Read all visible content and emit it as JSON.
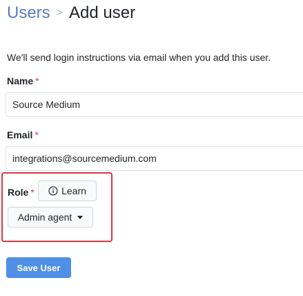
{
  "breadcrumb": {
    "parent": "Users",
    "separator": ">",
    "current": "Add user"
  },
  "intro": "We'll send login instructions via email when you add this user.",
  "form": {
    "required_mark": "*",
    "name": {
      "label": "Name",
      "value": "Source Medium"
    },
    "email": {
      "label": "Email",
      "value": "integrations@sourcemedium.com"
    },
    "role": {
      "label": "Role",
      "learn_label": "Learn",
      "selected": "Admin agent"
    },
    "save_label": "Save User"
  },
  "colors": {
    "link": "#5b7bc0",
    "required": "#dc3545",
    "highlight_border": "#dc3545",
    "primary_button": "#4f8fe6"
  },
  "icons": {
    "learn": "info-circle-icon",
    "dropdown": "caret-down-icon"
  }
}
